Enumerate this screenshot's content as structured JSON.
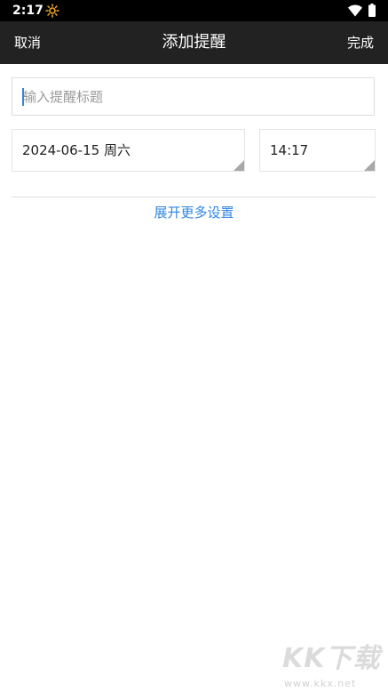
{
  "status_bar": {
    "time": "2:17",
    "icons": [
      "sun-icon",
      "wifi-icon",
      "battery-icon"
    ],
    "sun_color": "#f5a623"
  },
  "toolbar": {
    "cancel_label": "取消",
    "title": "添加提醒",
    "done_label": "完成",
    "background": "#222222"
  },
  "form": {
    "title_placeholder": "输入提醒标题",
    "title_value": "",
    "date_value": "2024-06-15 周六",
    "time_value": "14:17"
  },
  "expand_link": {
    "label": "展开更多设置",
    "color": "#2f86e0"
  },
  "watermark": {
    "logo": "KK下载",
    "url": "www.kkx.net"
  }
}
